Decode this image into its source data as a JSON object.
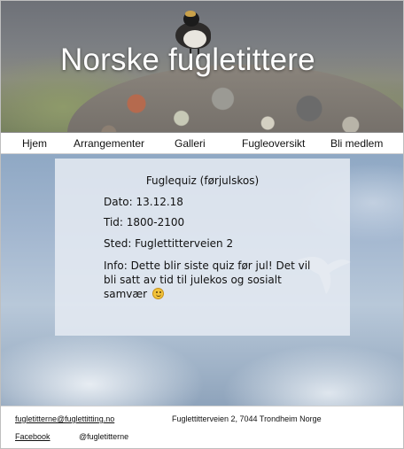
{
  "site": {
    "title": "Norske fugletittere"
  },
  "nav": {
    "items": [
      {
        "label": "Hjem"
      },
      {
        "label": "Arrangementer"
      },
      {
        "label": "Galleri"
      },
      {
        "label": "Fugleoversikt"
      },
      {
        "label": "Bli medlem"
      }
    ]
  },
  "event": {
    "title": "Fuglequiz (førjulskos)",
    "date": "Dato: 13.12.18",
    "time": "Tid: 1800-2100",
    "place": "Sted: Fuglettitterveien 2",
    "info": "Info: Dette blir siste quiz før jul! Det vil bli satt av tid til julekos og sosialt samvær",
    "emoji_icon": "smiley-icon"
  },
  "footer": {
    "email": "fugletitterne@fuglettitting.no",
    "address": "Fuglettitterveien 2, 7044 Trondheim Norge",
    "facebook_label": "Facebook",
    "handle": "@fugletitterne"
  }
}
